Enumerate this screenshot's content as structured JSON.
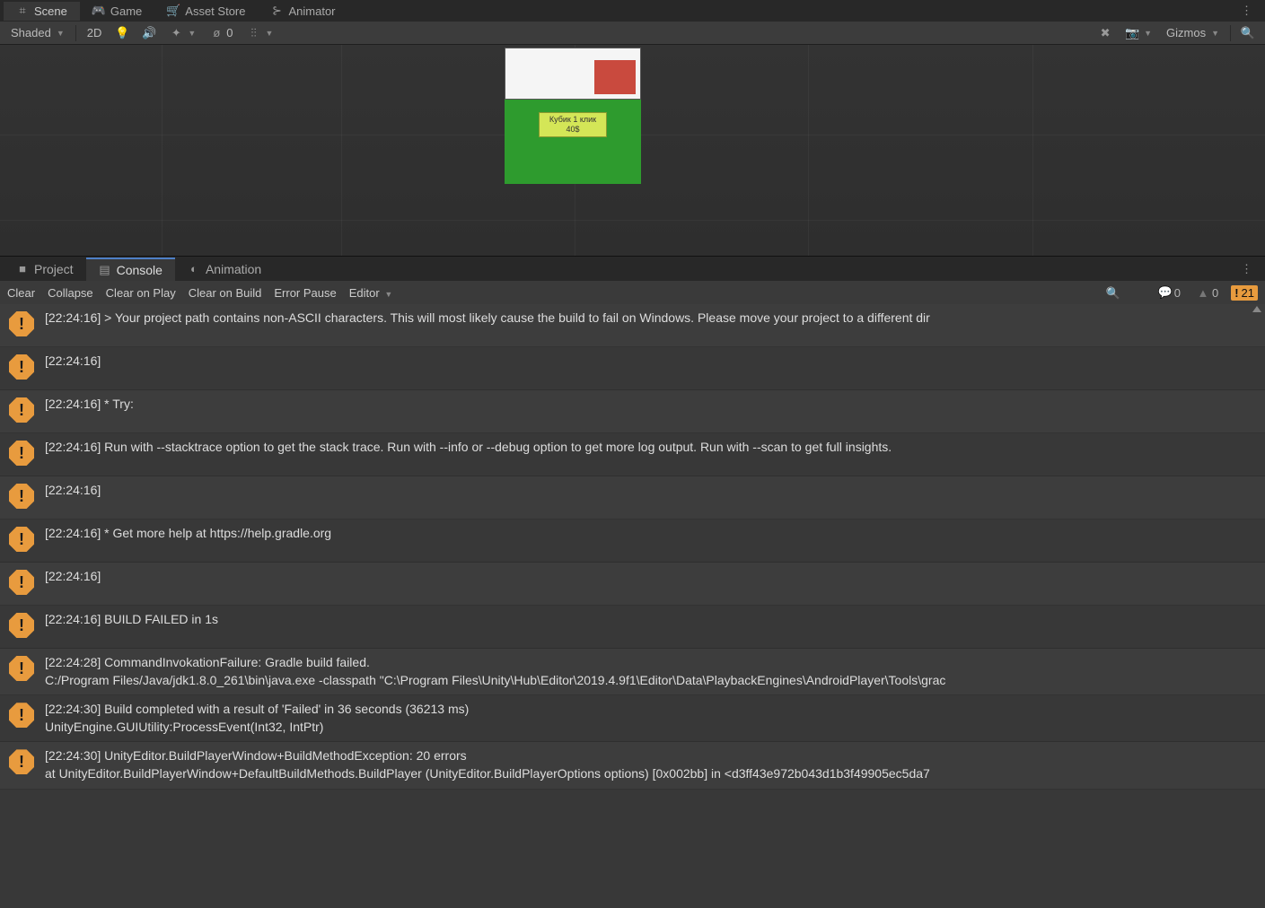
{
  "top_tabs": {
    "scene": "Scene",
    "game": "Game",
    "asset_store": "Asset Store",
    "animator": "Animator"
  },
  "scene_toolbar": {
    "shaded": "Shaded",
    "2d": "2D",
    "gizmos": "Gizmos",
    "zero": "0"
  },
  "scene_object_label": "Кубик 1 клик\n40$",
  "lower_tabs": {
    "project": "Project",
    "console": "Console",
    "animation": "Animation"
  },
  "console_toolbar": {
    "clear": "Clear",
    "collapse": "Collapse",
    "clear_on_play": "Clear on Play",
    "clear_on_build": "Clear on Build",
    "error_pause": "Error Pause",
    "editor": "Editor",
    "info_count": "0",
    "warn_count": "0",
    "error_count": "21"
  },
  "console_rows": [
    {
      "ts": "[22:24:16]",
      "msg": "   > Your project path contains non-ASCII characters. This will most likely cause the build to fail on Windows. Please move your project to a different dir",
      "sub": ""
    },
    {
      "ts": "[22:24:16]",
      "msg": "",
      "sub": ""
    },
    {
      "ts": "[22:24:16]",
      "msg": "* Try:",
      "sub": ""
    },
    {
      "ts": "[22:24:16]",
      "msg": "Run with --stacktrace option to get the stack trace. Run with --info or --debug option to get more log output. Run with --scan to get full insights.",
      "sub": ""
    },
    {
      "ts": "[22:24:16]",
      "msg": "",
      "sub": ""
    },
    {
      "ts": "[22:24:16]",
      "msg": "* Get more help at https://help.gradle.org",
      "sub": ""
    },
    {
      "ts": "[22:24:16]",
      "msg": "",
      "sub": ""
    },
    {
      "ts": "[22:24:16]",
      "msg": "BUILD FAILED in 1s",
      "sub": ""
    },
    {
      "ts": "[22:24:28]",
      "msg": "CommandInvokationFailure: Gradle build failed.",
      "sub": "C:/Program Files/Java/jdk1.8.0_261\\bin\\java.exe -classpath \"C:\\Program Files\\Unity\\Hub\\Editor\\2019.4.9f1\\Editor\\Data\\PlaybackEngines\\AndroidPlayer\\Tools\\grac"
    },
    {
      "ts": "[22:24:30]",
      "msg": "Build completed with a result of 'Failed' in 36 seconds (36213 ms)",
      "sub": "UnityEngine.GUIUtility:ProcessEvent(Int32, IntPtr)"
    },
    {
      "ts": "[22:24:30]",
      "msg": "UnityEditor.BuildPlayerWindow+BuildMethodException: 20 errors",
      "sub": "  at UnityEditor.BuildPlayerWindow+DefaultBuildMethods.BuildPlayer (UnityEditor.BuildPlayerOptions options) [0x002bb] in <d3ff43e972b043d1b3f49905ec5da7"
    }
  ]
}
